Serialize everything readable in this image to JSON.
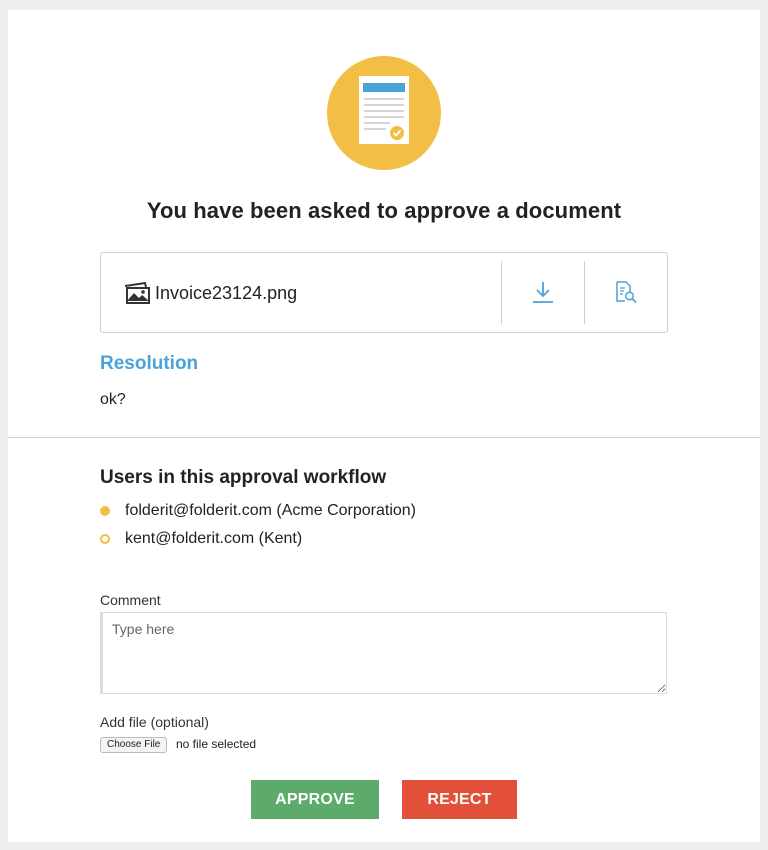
{
  "header": {
    "title": "You have been asked to approve a document",
    "hero_icon": "document-approval-icon"
  },
  "file": {
    "name": "Invoice23124.png",
    "type_icon": "image-file-icon",
    "actions": [
      "download-icon",
      "preview-icon"
    ]
  },
  "resolution": {
    "label": "Resolution",
    "text": "ok?"
  },
  "workflow": {
    "title": "Users in this approval workflow",
    "users": [
      {
        "label": "folderit@folderit.com (Acme Corporation)",
        "status": "completed"
      },
      {
        "label": "kent@folderit.com (Kent)",
        "status": "pending"
      }
    ]
  },
  "comment": {
    "label": "Comment",
    "placeholder": "Type here",
    "value": ""
  },
  "attachment": {
    "label": "Add file (optional)",
    "button_label": "Choose File",
    "status": "no file selected"
  },
  "actions": {
    "approve_label": "APPROVE",
    "reject_label": "REJECT"
  },
  "colors": {
    "accent": "#f2be45",
    "link": "#4aa3d6",
    "approve": "#5cab6a",
    "reject": "#e2503a"
  }
}
